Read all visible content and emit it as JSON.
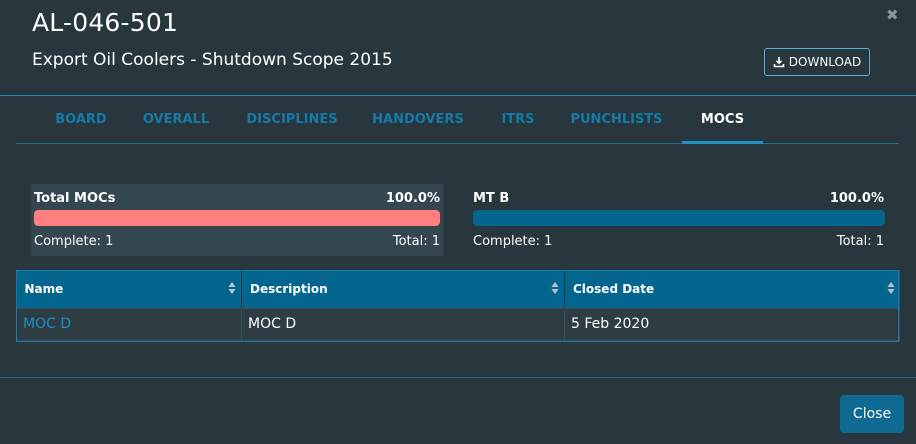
{
  "modal": {
    "title": "AL-046-501",
    "subtitle": "Export Oil Coolers - Shutdown Scope 2015",
    "close_symbol": "✖",
    "download_label": "DOWNLOAD",
    "close_button_label": "Close"
  },
  "tabs": [
    {
      "label": "BOARD",
      "active": false
    },
    {
      "label": "OVERALL",
      "active": false
    },
    {
      "label": "DISCIPLINES",
      "active": false
    },
    {
      "label": "HANDOVERS",
      "active": false
    },
    {
      "label": "ITRS",
      "active": false
    },
    {
      "label": "PUNCHLISTS",
      "active": false
    },
    {
      "label": "MOCS",
      "active": true
    }
  ],
  "stats": [
    {
      "name": "Total MOCs",
      "percent_label": "100.0%",
      "progress": 1.0,
      "complete_label": "Complete: 1",
      "total_label": "Total: 1",
      "bar_color": "#ff7f7f"
    },
    {
      "name": "MT B",
      "percent_label": "100.0%",
      "progress": 1.0,
      "complete_label": "Complete: 1",
      "total_label": "Total: 1",
      "bar_color": "#04668f"
    }
  ],
  "table": {
    "columns": [
      "Name",
      "Description",
      "Closed Date"
    ],
    "rows": [
      {
        "name": "MOC D",
        "description": "MOC D",
        "closed_date": "5 Feb 2020"
      }
    ]
  },
  "colors": {
    "background": "#28363d",
    "accent": "#1f8fc4",
    "header": "#04668f",
    "danger_bar": "#ff7f7f"
  },
  "icons": {
    "download": "download-icon",
    "sort": "sort-icon",
    "close": "close-icon"
  }
}
